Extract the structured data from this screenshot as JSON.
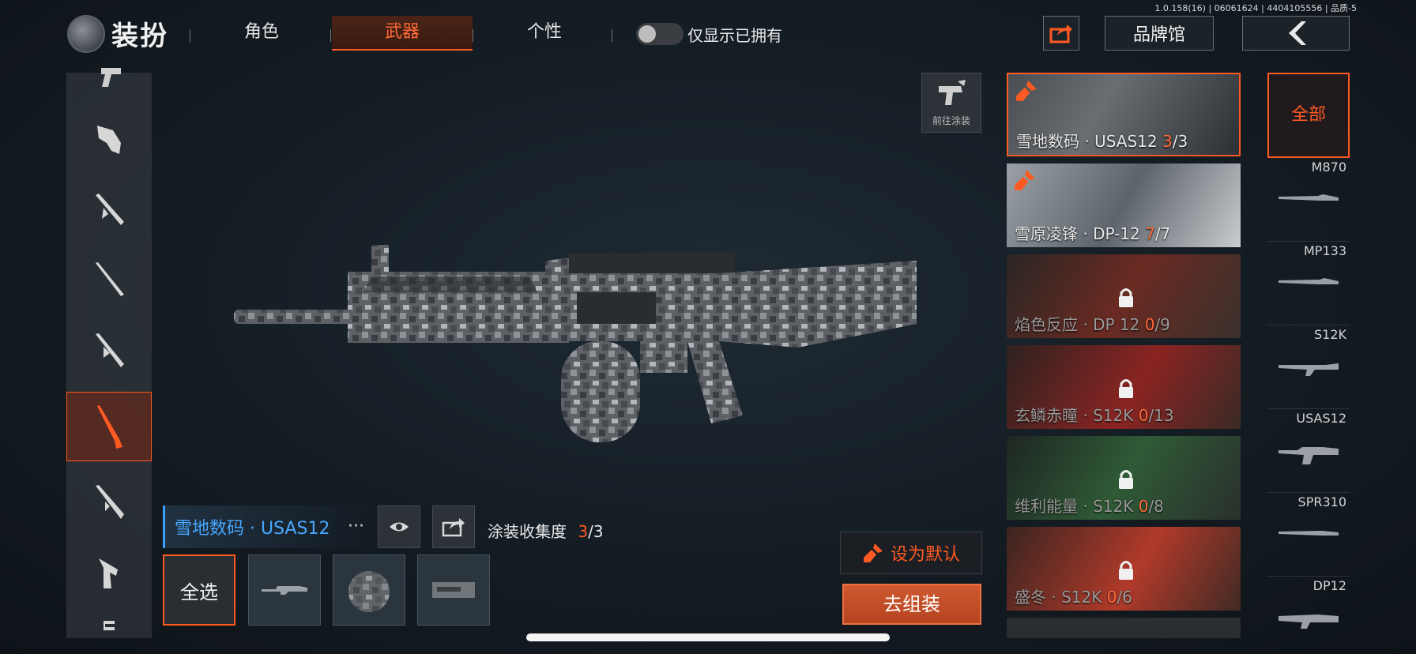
{
  "version_text": "1.0.158(16) | 06061624 | 4404105556 | 品质-5",
  "header": {
    "title": "装扮",
    "tabs": [
      {
        "label": "角色",
        "active": false
      },
      {
        "label": "武器",
        "active": true
      },
      {
        "label": "个性",
        "active": false
      }
    ],
    "toggle_label": "仅显示已拥有",
    "toggle_on": false,
    "brand_button": "品牌馆"
  },
  "weapon_list": {
    "icons": [
      "pistol-icon",
      "smg-icon",
      "smg-folding-icon",
      "rifle-icon",
      "assault-rifle-icon",
      "shotgun-icon",
      "carbine-icon",
      "pistol-heavy-icon",
      "magazine-icon"
    ],
    "active_index": 5
  },
  "paint_button": {
    "label": "前往涂装"
  },
  "skin_info": {
    "name": "雪地数码 · USAS12",
    "more": "···",
    "collect_label": "涂装收集度",
    "collect_owned": "3",
    "collect_total": "/3"
  },
  "parts": {
    "select_all": "全选",
    "items": [
      "full-gun-part-icon",
      "drum-magazine-part-icon",
      "receiver-part-icon"
    ]
  },
  "actions": {
    "set_default": "设为默认",
    "equip": "去组装"
  },
  "skins": [
    {
      "name": "雪地数码 · USAS12 ",
      "owned": "3",
      "total": "/3",
      "locked": false,
      "selected": true,
      "bg": "#5a5e62"
    },
    {
      "name": "雪原凌锋 · DP-12 ",
      "owned": "7",
      "total": "/7",
      "locked": false,
      "selected": false,
      "bg": "#6a7078"
    },
    {
      "name": "焰色反应 · DP 12 ",
      "owned": "0",
      "total": "/9",
      "locked": true,
      "selected": false,
      "bg": "#3a2a26"
    },
    {
      "name": "玄鳞赤瞳 · S12K ",
      "owned": "0",
      "total": "/13",
      "locked": true,
      "selected": false,
      "bg": "#3c2422"
    },
    {
      "name": "维利能量 · S12K ",
      "owned": "0",
      "total": "/8",
      "locked": true,
      "selected": false,
      "bg": "#22302a"
    },
    {
      "name": "盛冬 · S12K ",
      "owned": "0",
      "total": "/6",
      "locked": true,
      "selected": false,
      "bg": "#3e2622"
    }
  ],
  "categories": {
    "all": "全部",
    "items": [
      "M870",
      "MP133",
      "S12K",
      "USAS12",
      "SPR310",
      "DP12"
    ]
  },
  "colors": {
    "accent": "#ff5a22",
    "link": "#47a8ff"
  }
}
